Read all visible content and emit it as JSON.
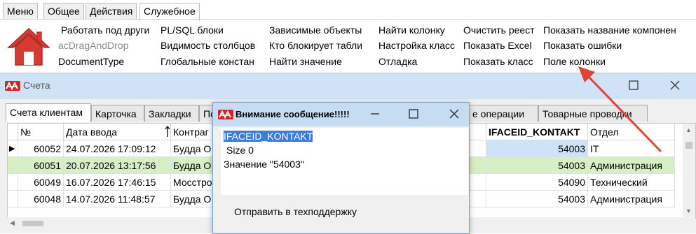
{
  "ribbon": {
    "tabs": [
      {
        "label": "Меню"
      },
      {
        "label": "Общее"
      },
      {
        "label": "Действия"
      },
      {
        "label": "Служебное"
      }
    ],
    "groups": [
      {
        "items": [
          "Работать под други",
          "acDragAndDrop",
          "DocumentType"
        ]
      },
      {
        "items": [
          "PL/SQL блоки",
          "Видимость  столбцов",
          "Глобальные констан"
        ]
      },
      {
        "items": [
          "Зависимые объекты",
          "Кто блокирует табли",
          "Найти значение"
        ]
      },
      {
        "items": [
          "Найти колонку",
          "Настройка класс",
          "Отладка"
        ]
      },
      {
        "items": [
          "Очистить реест",
          "Показать Excel",
          "Показать класс"
        ]
      },
      {
        "items": [
          "Показать название компонен",
          "Показать ошибки",
          "Поле колонки"
        ]
      }
    ],
    "colors": {
      "arrow": "#e34234",
      "house": "#d63a32"
    }
  },
  "window": {
    "title": "Счета",
    "tabs": [
      "Счета клиентам",
      "Карточка",
      "Закладки",
      "По",
      "е операции",
      "Товарные проводки"
    ],
    "grid": {
      "headers": [
        "№",
        "Дата ввода",
        "Контраг",
        "IFACEID_KONTAKT",
        "Отдел"
      ],
      "rows": [
        {
          "num": "60052",
          "date": "24.07.2026 17:09:12",
          "kontr": "Будда О",
          "kontakt": "54003",
          "otdel": "IT"
        },
        {
          "num": "60051",
          "date": "20.07.2026 13:17:56",
          "kontr": "Будда О",
          "kontakt": "54003",
          "otdel": "Администрация"
        },
        {
          "num": "60049",
          "date": "16.07.2026 17:46:15",
          "kontr": "Мосстро",
          "kontakt": "54090",
          "otdel": "Технический"
        },
        {
          "num": "60048",
          "date": "14.07.2026 11:48:57",
          "kontr": "Будда О",
          "kontakt": "54003",
          "otdel": "Администрация"
        }
      ],
      "colors": {
        "selected_row": "#d7efc6",
        "focus_cell": "#cfe3f6"
      }
    }
  },
  "dialog": {
    "title": "Внимание сообщение!!!!!",
    "lines": [
      "IFACEID_KONTAKT",
      "Size 0",
      "Значение \"54003\""
    ],
    "support_button": "Отправить в техподдержку"
  }
}
